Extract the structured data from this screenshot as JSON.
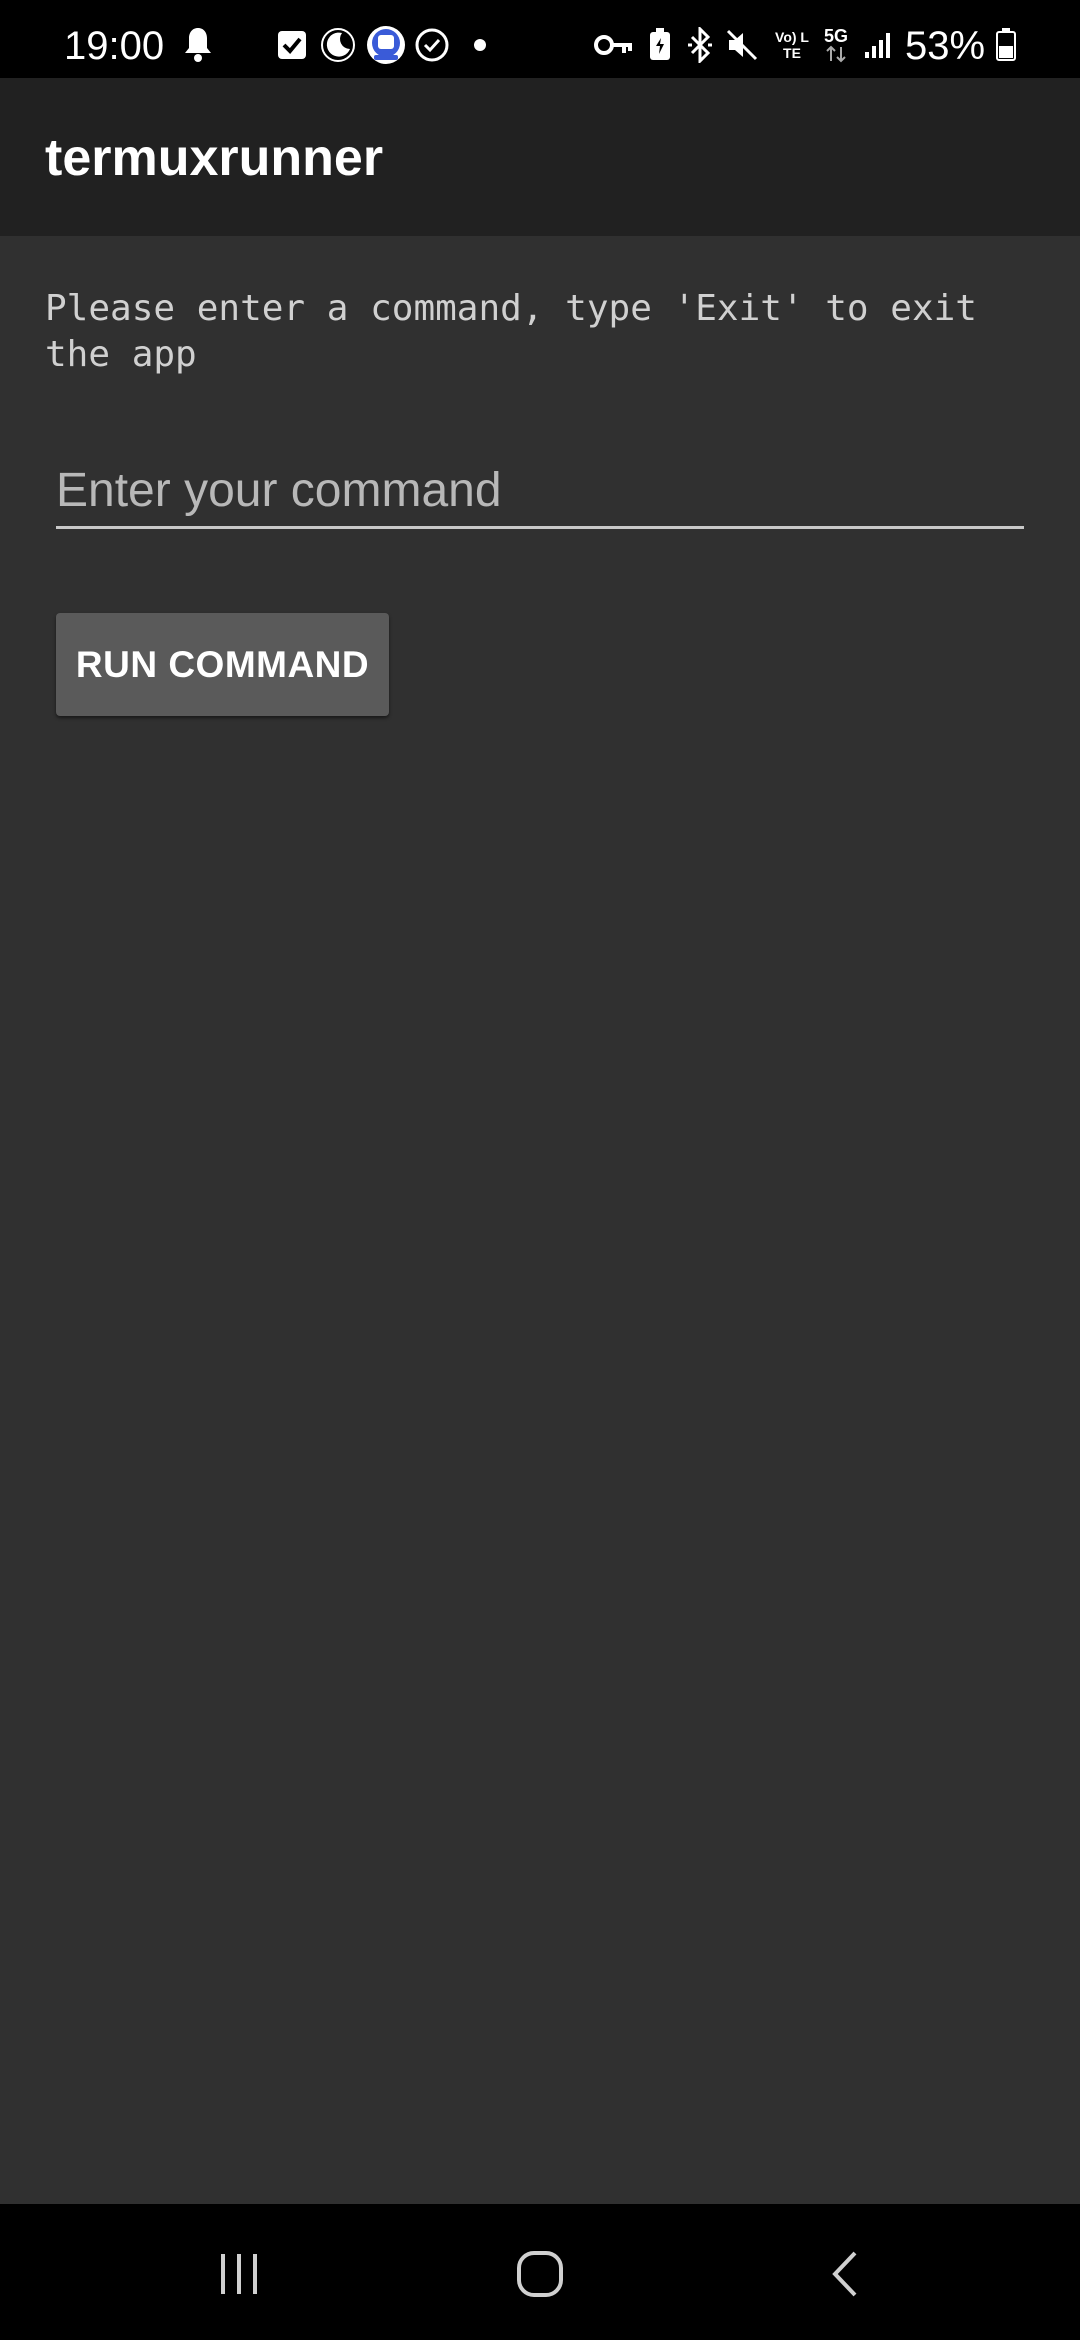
{
  "status_bar": {
    "time": "19:00",
    "battery_percent": "53%",
    "network": "5G",
    "volte": "Vo) LTE",
    "notification_icons": [
      "bell-icon",
      "checkbox-icon",
      "moon-icon",
      "app-icon",
      "check-circle-icon",
      "dot-icon"
    ],
    "system_icons": [
      "key-icon",
      "battery-saver-icon",
      "bluetooth-icon",
      "mute-icon",
      "volte-icon",
      "5g-icon",
      "signal-icon",
      "battery-icon"
    ]
  },
  "app_bar": {
    "title": "termuxrunner"
  },
  "main": {
    "prompt": "Please enter a command, type 'Exit' to exit the app",
    "command_input": {
      "placeholder": "Enter your command",
      "value": ""
    },
    "run_button_label": "RUN COMMAND"
  },
  "nav_bar": {
    "buttons": [
      "recent-apps-icon",
      "home-icon",
      "back-icon"
    ]
  },
  "colors": {
    "app_bar": "#212121",
    "background": "#303030",
    "button": "#5a5a5a",
    "status_bar": "#000000"
  }
}
